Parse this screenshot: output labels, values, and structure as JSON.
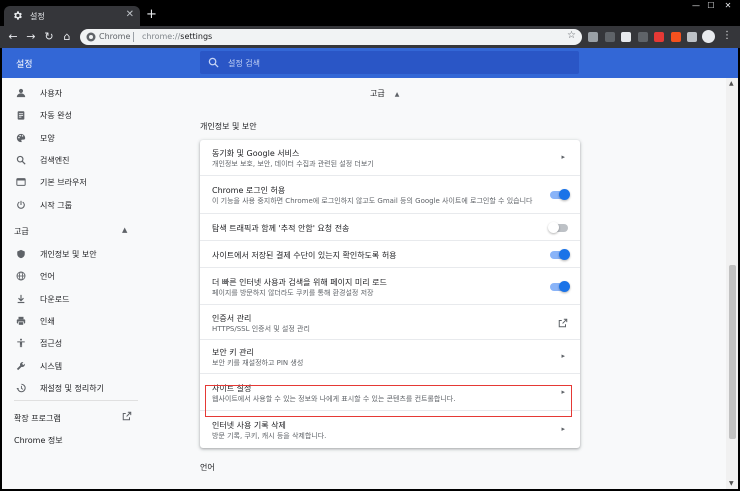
{
  "browser": {
    "tab_title": "설정",
    "tab_close": "✕",
    "new_tab": "+",
    "window_min": "—",
    "window_max": "☐",
    "window_close": "✕",
    "omnibox_chip": "Chrome",
    "url_scheme": "chrome://",
    "url_path": "settings",
    "icons": {
      "tab": "gear-icon",
      "back": "arrow-left-icon",
      "forward": "arrow-right-icon",
      "reload": "reload-icon",
      "home": "home-icon",
      "site": "chrome-info-icon",
      "star": "star-icon",
      "menu": "kebab-menu-icon"
    },
    "extension_colors": [
      "#9aa0a6",
      "#5f6368",
      "#e8eaed",
      "#5f6368",
      "#e53935",
      "#f4511e",
      "#bdc1c6"
    ]
  },
  "header": {
    "title": "설정",
    "search_placeholder": "설정 검색",
    "color": "#3367d6"
  },
  "sidebar": {
    "items": [
      {
        "label": "사용자",
        "icon": "person-icon"
      },
      {
        "label": "자동 완성",
        "icon": "clipboard-icon"
      },
      {
        "label": "모양",
        "icon": "palette-icon"
      },
      {
        "label": "검색엔진",
        "icon": "search-icon"
      },
      {
        "label": "기본 브라우저",
        "icon": "browser-icon"
      },
      {
        "label": "시작 그룹",
        "icon": "power-icon"
      }
    ],
    "advanced_label": "고급",
    "advanced_items": [
      {
        "label": "개인정보 및 보안",
        "icon": "shield-icon"
      },
      {
        "label": "언어",
        "icon": "globe-icon"
      },
      {
        "label": "다운로드",
        "icon": "download-icon"
      },
      {
        "label": "인쇄",
        "icon": "printer-icon"
      },
      {
        "label": "접근성",
        "icon": "accessibility-icon"
      },
      {
        "label": "시스템",
        "icon": "wrench-icon"
      },
      {
        "label": "재설정 및 정리하기",
        "icon": "restore-icon"
      }
    ],
    "extensions_label": "확장 프로그램",
    "about_label": "Chrome 정보"
  },
  "main": {
    "advanced_toggle": "고급",
    "section_title": "개인정보 및 보안",
    "rows": [
      {
        "title": "동기화 및 Google 서비스",
        "subtitle": "개인정보 보호, 보안, 데이터 수집과 관련된 설정 더보기",
        "control": "arrow"
      },
      {
        "title": "Chrome 로그인 허용",
        "subtitle": "이 기능을 사용 중지하면 Chrome에 로그인하지 않고도 Gmail 등의 Google 사이트에 로그인할 수 있습니다",
        "control": "toggle",
        "on": true
      },
      {
        "title": "탐색 트래픽과 함께 '추적 안함' 요청 전송",
        "subtitle": "",
        "control": "toggle",
        "on": false
      },
      {
        "title": "사이트에서 저장된 결제 수단이 있는지 확인하도록 허용",
        "subtitle": "",
        "control": "toggle",
        "on": true
      },
      {
        "title": "더 빠른 인터넷 사용과 검색을 위해 페이지 미리 로드",
        "subtitle": "페이지를 방문하지 않더라도 쿠키를 통해 환경설정 저장",
        "control": "toggle",
        "on": true
      },
      {
        "title": "인증서 관리",
        "subtitle": "HTTPS/SSL 인증서 및 설정 관리",
        "control": "external"
      },
      {
        "title": "보안 키 관리",
        "subtitle": "보안 키를 재설정하고 PIN 생성",
        "control": "arrow"
      },
      {
        "title": "사이트 설정",
        "subtitle": "웹사이트에서 사용할 수 있는 정보와 나에게 표시할 수 있는 콘텐츠를 컨트롤합니다.",
        "control": "arrow"
      },
      {
        "title": "인터넷 사용 기록 삭제",
        "subtitle": "방문 기록, 쿠키, 캐시 등을 삭제합니다.",
        "control": "arrow"
      }
    ],
    "language_section": "언어",
    "highlight_color": "#e53935"
  }
}
